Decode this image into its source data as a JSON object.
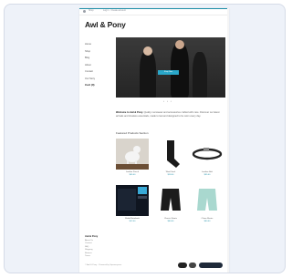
{
  "site": {
    "brand": "Awl & Pony"
  },
  "topbar": {
    "left": "Shop",
    "mid": "Log in  ·  Create account"
  },
  "nav": {
    "items": [
      "Home",
      "Shop",
      "Blog",
      "About",
      "Contact",
      "Our Story"
    ],
    "cart": "Cart (0)"
  },
  "hero": {
    "cta": "Shop Now",
    "dots": "• • •"
  },
  "intro": {
    "lead": "Welcome to Awl & Pony.",
    "text": "Quality menswear and accessories crafted with care. Discover our latest arrivals and timeless essentials, made to last and designed to be worn every day."
  },
  "featured": {
    "title": "Featured Products Section",
    "products": [
      {
        "name": "Leather Pouch",
        "price": "$45.00",
        "icon": "dog-figurine-icon"
      },
      {
        "name": "Wool Sock",
        "price": "$18.00",
        "icon": "sock-icon"
      },
      {
        "name": "Leather Belt",
        "price": "$55.00",
        "icon": "belt-icon"
      },
      {
        "name": "Ruled Notebook",
        "price": "$12.00",
        "icon": "notebook-icon"
      },
      {
        "name": "Classic Shorts",
        "price": "$60.00",
        "icon": "shorts-icon"
      },
      {
        "name": "Chino Shorts",
        "price": "$60.00",
        "icon": "shorts-icon"
      }
    ]
  },
  "footer": {
    "heading": "Awl & Pony",
    "links": [
      "About Us",
      "Contact",
      "FAQ",
      "Shipping",
      "Returns",
      "Terms"
    ],
    "copyright": "© Awl & Pony · Powered by Squarespace"
  },
  "colors": {
    "accent": "#2aa7c9",
    "frame": "#eef2f9"
  }
}
